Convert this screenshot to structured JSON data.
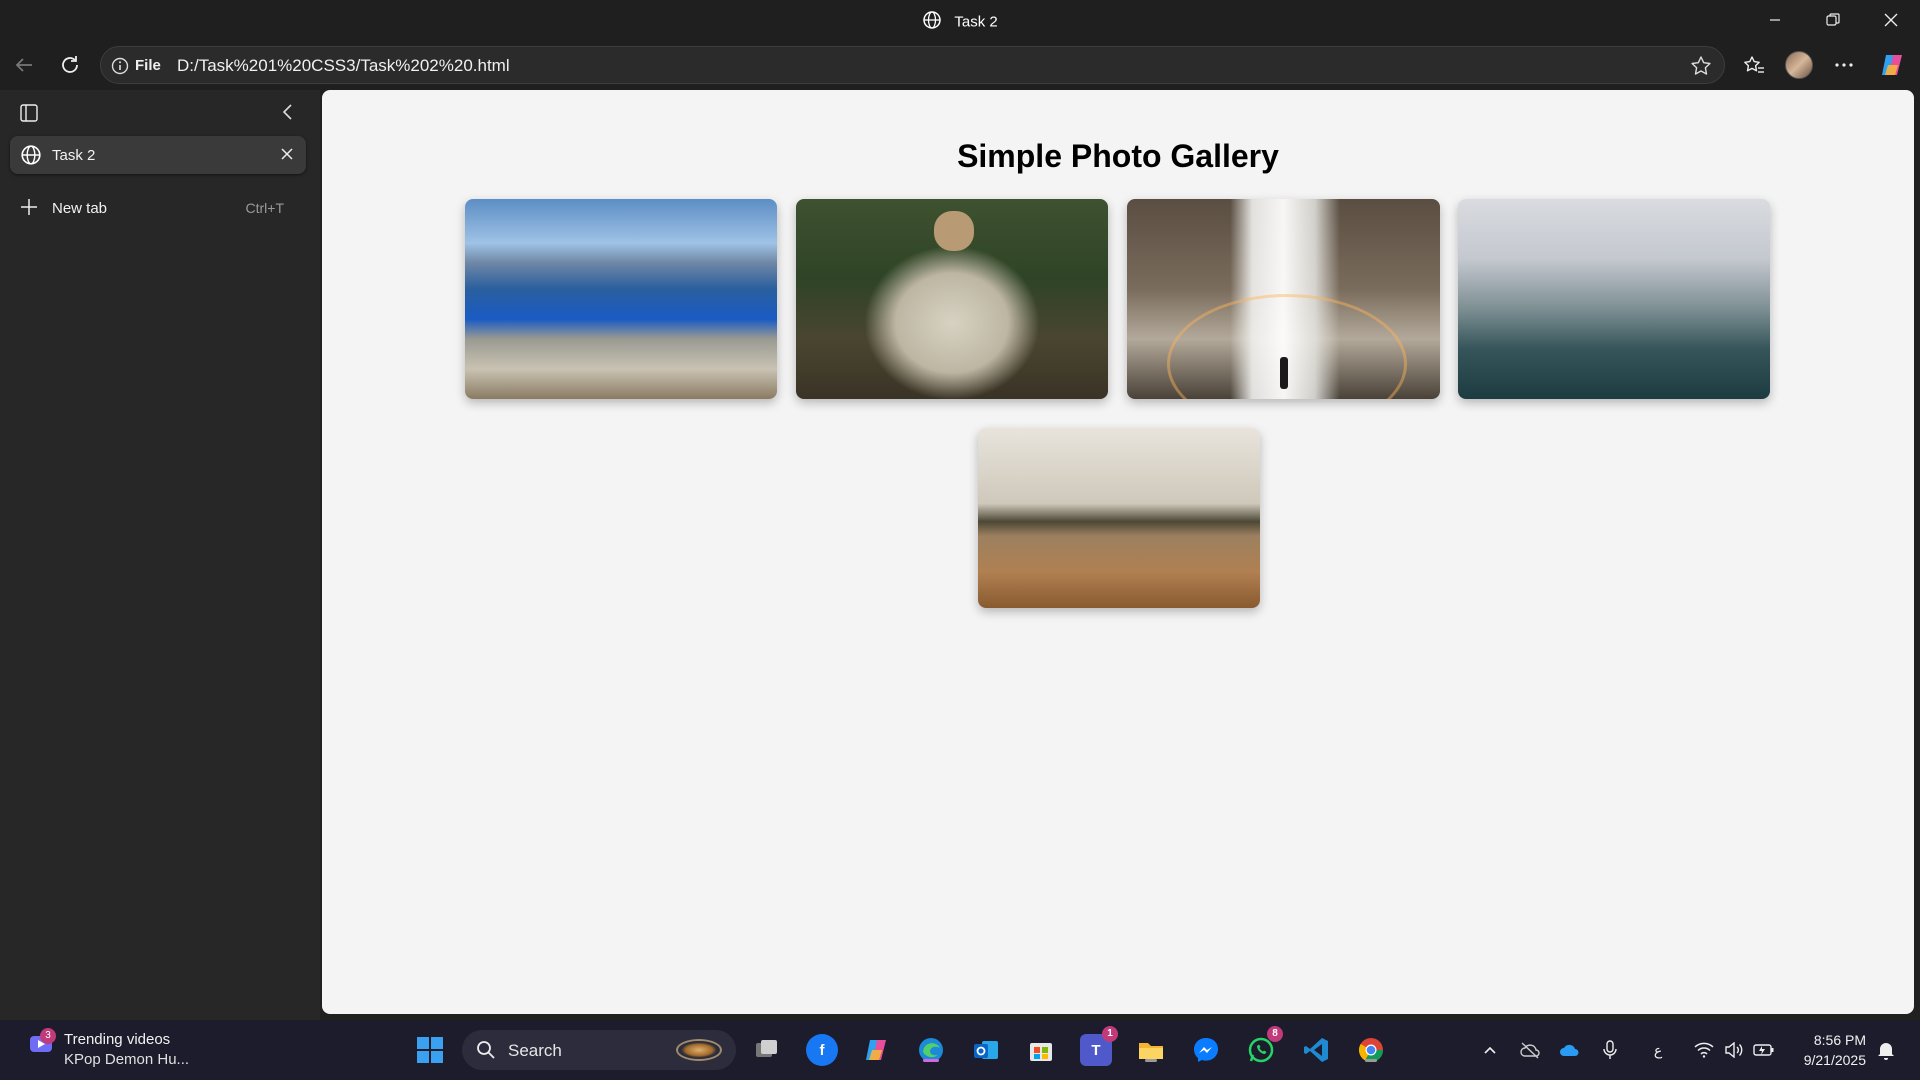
{
  "window": {
    "title": "Task 2"
  },
  "toolbar": {
    "file_label": "File",
    "url": "D:/Task%201%20CSS3/Task%202%20.html"
  },
  "sidebar": {
    "tabs": [
      {
        "label": "Task 2"
      }
    ],
    "new_tab": {
      "label": "New tab",
      "shortcut": "Ctrl+T"
    }
  },
  "page": {
    "heading": "Simple Photo Gallery",
    "photos": [
      {
        "subject": "fjord-cliff"
      },
      {
        "subject": "pug-in-blanket"
      },
      {
        "subject": "waterfall-rainbow"
      },
      {
        "subject": "misty-mountains"
      },
      {
        "subject": "beach-shore"
      }
    ]
  },
  "taskbar": {
    "widget": {
      "title": "Trending videos",
      "subtitle": "KPop Demon Hu...",
      "badge": "3"
    },
    "search_label": "Search",
    "badges": {
      "teams": "1",
      "whatsapp": "8"
    },
    "keyboard_lang": "ع",
    "time": "8:56 PM",
    "date": "9/21/2025"
  },
  "colors": {
    "chrome": "#1f1f1f",
    "sidebar": "#272727",
    "page_bg": "#f4f4f4",
    "taskbar": "#1c1c2c"
  }
}
